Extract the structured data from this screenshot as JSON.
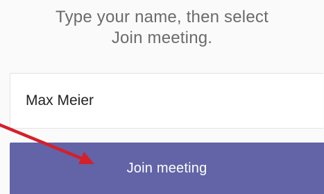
{
  "instructions": {
    "line1": "Type your name, then select",
    "line2": "Join meeting."
  },
  "name_field": {
    "value": "Max Meier"
  },
  "join_button": {
    "label": "Join meeting"
  },
  "annotation": {
    "arrow_icon": "red-arrow-icon",
    "arrow_color": "#d4202b"
  },
  "colors": {
    "button": "#6264a7",
    "instruction_text": "#6b6b6b"
  }
}
